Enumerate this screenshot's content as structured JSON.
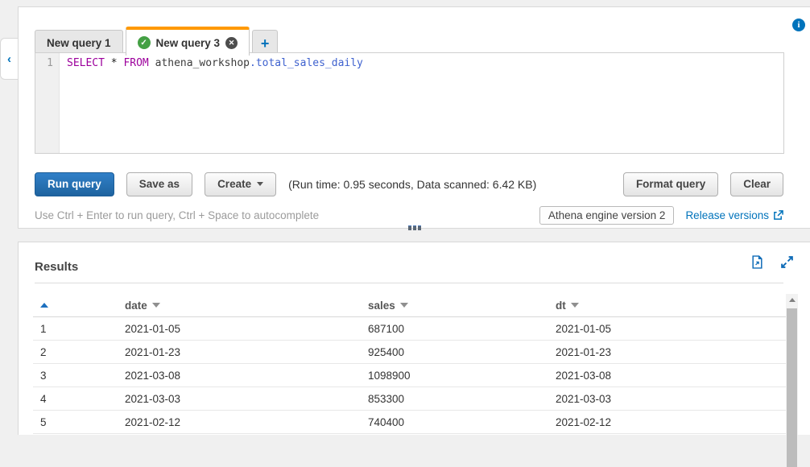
{
  "colors": {
    "accent_orange": "#ff9900",
    "link_blue": "#0073bb",
    "button_blue": "#1f66ad",
    "success_green": "#44a044",
    "keyword_purple": "#9c009c",
    "identifier_blue": "#3f62cf"
  },
  "editor_panel": {
    "tabs": [
      {
        "label": "New query 1",
        "active": false
      },
      {
        "label": "New query 3",
        "active": true
      }
    ],
    "new_tab_label": "+",
    "sql": {
      "line_number": "1",
      "select": "SELECT",
      "star": "*",
      "from": "FROM",
      "schema": "athena_workshop",
      "table": ".total_sales_daily"
    },
    "toolbar": {
      "run_query": "Run query",
      "save_as": "Save as",
      "create": "Create",
      "stats": "(Run time: 0.95 seconds, Data scanned: 6.42 KB)",
      "format_query": "Format query",
      "clear": "Clear"
    },
    "status": {
      "hint": "Use Ctrl + Enter to run query, Ctrl + Space to autocomplete",
      "engine_badge": "Athena engine version 2",
      "release_link": "Release versions"
    }
  },
  "icons": {
    "check": "✓",
    "close": "✕",
    "plus": "+",
    "chevron_left": "‹",
    "info": "i"
  },
  "results": {
    "title": "Results",
    "columns": [
      "date",
      "sales",
      "dt"
    ],
    "rows": [
      {
        "n": "1",
        "date": "2021-01-05",
        "sales": "687100",
        "dt": "2021-01-05"
      },
      {
        "n": "2",
        "date": "2021-01-23",
        "sales": "925400",
        "dt": "2021-01-23"
      },
      {
        "n": "3",
        "date": "2021-03-08",
        "sales": "1098900",
        "dt": "2021-03-08"
      },
      {
        "n": "4",
        "date": "2021-03-03",
        "sales": "853300",
        "dt": "2021-03-03"
      },
      {
        "n": "5",
        "date": "2021-02-12",
        "sales": "740400",
        "dt": "2021-02-12"
      }
    ]
  }
}
